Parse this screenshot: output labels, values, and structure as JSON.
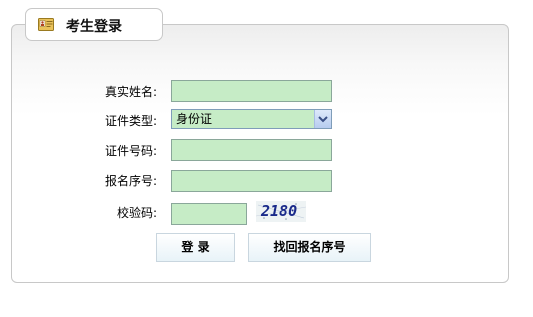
{
  "header": {
    "title": "考生登录",
    "icon": "id-card-icon"
  },
  "form": {
    "real_name_label": "真实姓名:",
    "real_name_value": "",
    "id_type_label": "证件类型:",
    "id_type_selected": "身份证",
    "id_number_label": "证件号码:",
    "id_number_value": "",
    "registration_no_label": "报名序号:",
    "registration_no_value": "",
    "captcha_label": "校验码:",
    "captcha_value": "",
    "captcha_image_text": "2180"
  },
  "buttons": {
    "login_label": "登 录",
    "retrieve_label": "找回报名序号"
  },
  "colors": {
    "input_bg": "#c6ecc6",
    "panel_border": "#c8c8c8",
    "button_bg": "#e8f3f8"
  }
}
